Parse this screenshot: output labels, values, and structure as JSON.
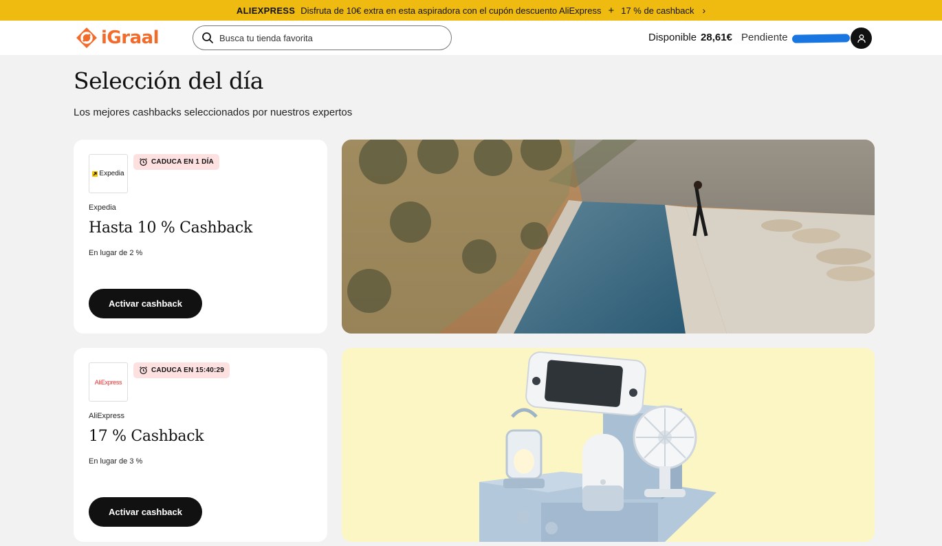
{
  "promo": {
    "brand": "ALIEXPRESS",
    "text": "Disfruta de 10€ extra en esta aspiradora con el cupón descuento AliExpress",
    "plus": "+",
    "extra": "17 % de cashback"
  },
  "header": {
    "logo_text": "iGraal",
    "search_placeholder": "Busca tu tienda favorita",
    "available_label": "Disponible",
    "available_amount": "28,61€",
    "pending_label": "Pendiente"
  },
  "page": {
    "title": "Selección del día",
    "subtitle": "Los mejores cashbacks seleccionados por nuestros expertos"
  },
  "offers": [
    {
      "logo_text": "Expedia",
      "badge": "CADUCA EN 1 DÍA",
      "merchant": "Expedia",
      "cashback": "Hasta 10 % Cashback",
      "instead": "En lugar de 2 %",
      "button": "Activar cashback"
    },
    {
      "logo_text": "AliExpress",
      "badge": "CADUCA EN 15:40:29",
      "merchant": "AliExpress",
      "cashback": "17 % Cashback",
      "instead": "En lugar de 3 %",
      "button": "Activar cashback"
    }
  ],
  "colors": {
    "promo_bg": "#f0bb10",
    "brand_orange": "#f26b2a",
    "badge_bg": "#fde0e0",
    "button_bg": "#111111",
    "aliexpress_red": "#e62e2e",
    "banner2_bg": "#fcf6c4"
  }
}
